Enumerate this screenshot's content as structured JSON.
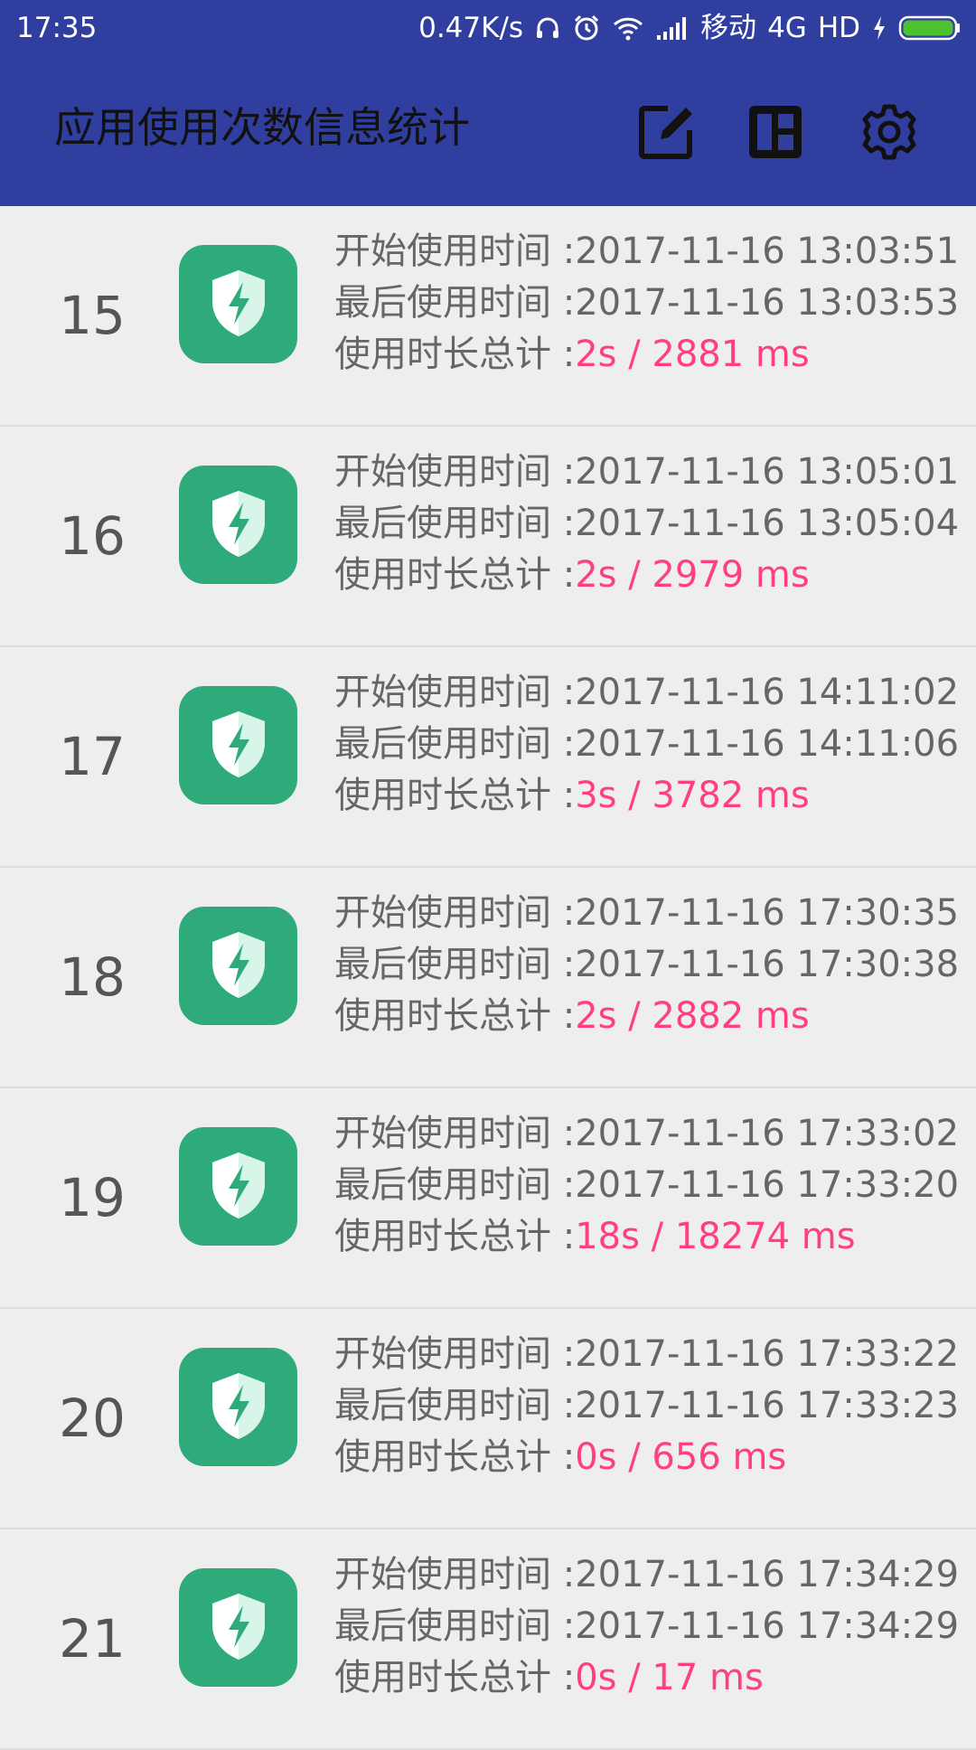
{
  "status_bar": {
    "time": "17:35",
    "speed": "0.47K/s",
    "carrier": "移动",
    "network": "4G",
    "hd": "HD",
    "icons": [
      "headphones-icon",
      "alarm-icon",
      "wifi-icon",
      "signal-icon",
      "charging-icon",
      "battery-icon"
    ]
  },
  "app_bar": {
    "title": "应用使用次数信息统计",
    "actions": [
      "edit-icon",
      "dashboard-icon",
      "settings-icon"
    ],
    "background_color": "#303f9f"
  },
  "labels": {
    "start": "开始使用时间 :",
    "last": "最后使用时间 :",
    "total": "使用时长总计 :"
  },
  "colors": {
    "icon_bg": "#2faa7b",
    "duration": "#ff3f7f",
    "text": "#666666"
  },
  "rows": [
    {
      "index": "15",
      "start": "2017-11-16 13:03:51",
      "last": "2017-11-16 13:03:53",
      "total": "2s / 2881 ms"
    },
    {
      "index": "16",
      "start": "2017-11-16 13:05:01",
      "last": "2017-11-16 13:05:04",
      "total": "2s / 2979 ms"
    },
    {
      "index": "17",
      "start": "2017-11-16 14:11:02",
      "last": "2017-11-16 14:11:06",
      "total": "3s / 3782 ms"
    },
    {
      "index": "18",
      "start": "2017-11-16 17:30:35",
      "last": "2017-11-16 17:30:38",
      "total": "2s / 2882 ms"
    },
    {
      "index": "19",
      "start": "2017-11-16 17:33:02",
      "last": "2017-11-16 17:33:20",
      "total": "18s / 18274 ms"
    },
    {
      "index": "20",
      "start": "2017-11-16 17:33:22",
      "last": "2017-11-16 17:33:23",
      "total": "0s / 656 ms"
    },
    {
      "index": "21",
      "start": "2017-11-16 17:34:29",
      "last": "2017-11-16 17:34:29",
      "total": "0s / 17 ms"
    }
  ]
}
